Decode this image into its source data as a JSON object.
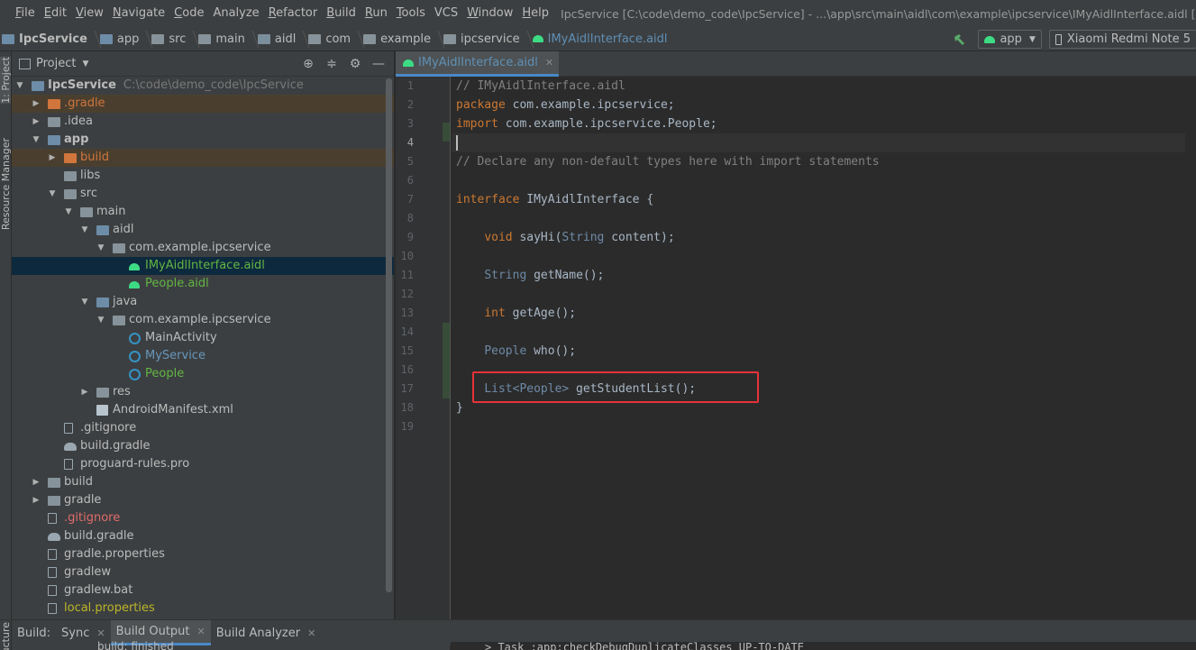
{
  "menubar": {
    "items": [
      {
        "label": "File",
        "u": "F",
        "rest": "ile"
      },
      {
        "label": "Edit",
        "u": "E",
        "rest": "dit"
      },
      {
        "label": "View",
        "u": "V",
        "rest": "iew"
      },
      {
        "label": "Navigate",
        "u": "N",
        "rest": "avigate"
      },
      {
        "label": "Code",
        "u": "C",
        "rest": "ode"
      },
      {
        "label": "Analyze",
        "u": "",
        "rest": "Analyze"
      },
      {
        "label": "Refactor",
        "u": "R",
        "rest": "efactor"
      },
      {
        "label": "Build",
        "u": "B",
        "rest": "uild"
      },
      {
        "label": "Run",
        "u": "R",
        "rest": "un"
      },
      {
        "label": "Tools",
        "u": "T",
        "rest": "ools"
      },
      {
        "label": "VCS",
        "u": "",
        "rest": "VCS"
      },
      {
        "label": "Window",
        "u": "W",
        "rest": "indow"
      },
      {
        "label": "Help",
        "u": "H",
        "rest": "elp"
      }
    ],
    "window_title": "IpcService [C:\\code\\demo_code\\IpcService] - ...\\app\\src\\main\\aidl\\com\\example\\ipcservice\\IMyAidlInterface.aidl [app] - Ar"
  },
  "breadcrumb": {
    "items": [
      "IpcService",
      "app",
      "src",
      "main",
      "aidl",
      "com",
      "example",
      "ipcservice",
      "IMyAidlInterface.aidl"
    ]
  },
  "run_tools": {
    "config": "app",
    "device": "Xiaomi Redmi Note 5"
  },
  "left_strip": {
    "project_tab": "1: Project",
    "resource_tab": "Resource Manager"
  },
  "project_panel": {
    "title": "Project",
    "root_name": "IpcService",
    "root_path": "C:\\code\\demo_code\\IpcService",
    "tree": [
      {
        "label": ".gradle",
        "depth": 1,
        "arrow": "right",
        "icon": "folder-orange",
        "style": "orange",
        "row": "excluded"
      },
      {
        "label": ".idea",
        "depth": 1,
        "arrow": "right",
        "icon": "folder",
        "style": "",
        "row": ""
      },
      {
        "label": "app",
        "depth": 1,
        "arrow": "down",
        "icon": "folder-blue",
        "style": "bold",
        "row": ""
      },
      {
        "label": "build",
        "depth": 2,
        "arrow": "right",
        "icon": "folder-orange",
        "style": "orange",
        "row": "excluded"
      },
      {
        "label": "libs",
        "depth": 2,
        "arrow": "",
        "icon": "folder",
        "style": "",
        "row": ""
      },
      {
        "label": "src",
        "depth": 2,
        "arrow": "down",
        "icon": "folder",
        "style": "",
        "row": ""
      },
      {
        "label": "main",
        "depth": 3,
        "arrow": "down",
        "icon": "folder",
        "style": "",
        "row": ""
      },
      {
        "label": "aidl",
        "depth": 4,
        "arrow": "down",
        "icon": "folder-blue",
        "style": "",
        "row": ""
      },
      {
        "label": "com.example.ipcservice",
        "depth": 5,
        "arrow": "down",
        "icon": "pkg",
        "style": "",
        "row": ""
      },
      {
        "label": "IMyAidlInterface.aidl",
        "depth": 6,
        "arrow": "",
        "icon": "android",
        "style": "green",
        "row": "selected"
      },
      {
        "label": "People.aidl",
        "depth": 6,
        "arrow": "",
        "icon": "android",
        "style": "green",
        "row": ""
      },
      {
        "label": "java",
        "depth": 4,
        "arrow": "down",
        "icon": "folder-blue",
        "style": "",
        "row": ""
      },
      {
        "label": "com.example.ipcservice",
        "depth": 5,
        "arrow": "down",
        "icon": "pkg",
        "style": "",
        "row": ""
      },
      {
        "label": "MainActivity",
        "depth": 6,
        "arrow": "",
        "icon": "class",
        "style": "",
        "row": ""
      },
      {
        "label": "MyService",
        "depth": 6,
        "arrow": "",
        "icon": "class",
        "style": "blue",
        "row": ""
      },
      {
        "label": "People",
        "depth": 6,
        "arrow": "",
        "icon": "class",
        "style": "green",
        "row": ""
      },
      {
        "label": "res",
        "depth": 4,
        "arrow": "right",
        "icon": "folder",
        "style": "",
        "row": ""
      },
      {
        "label": "AndroidManifest.xml",
        "depth": 4,
        "arrow": "",
        "icon": "manifest",
        "style": "",
        "row": ""
      },
      {
        "label": ".gitignore",
        "depth": 2,
        "arrow": "",
        "icon": "file",
        "style": "",
        "row": ""
      },
      {
        "label": "build.gradle",
        "depth": 2,
        "arrow": "",
        "icon": "gradle",
        "style": "",
        "row": ""
      },
      {
        "label": "proguard-rules.pro",
        "depth": 2,
        "arrow": "",
        "icon": "file",
        "style": "",
        "row": ""
      },
      {
        "label": "build",
        "depth": 1,
        "arrow": "right",
        "icon": "folder",
        "style": "",
        "row": ""
      },
      {
        "label": "gradle",
        "depth": 1,
        "arrow": "right",
        "icon": "folder",
        "style": "",
        "row": ""
      },
      {
        "label": ".gitignore",
        "depth": 1,
        "arrow": "",
        "icon": "file",
        "style": "red",
        "row": ""
      },
      {
        "label": "build.gradle",
        "depth": 1,
        "arrow": "",
        "icon": "gradle",
        "style": "",
        "row": ""
      },
      {
        "label": "gradle.properties",
        "depth": 1,
        "arrow": "",
        "icon": "file",
        "style": "",
        "row": ""
      },
      {
        "label": "gradlew",
        "depth": 1,
        "arrow": "",
        "icon": "file",
        "style": "",
        "row": ""
      },
      {
        "label": "gradlew.bat",
        "depth": 1,
        "arrow": "",
        "icon": "file",
        "style": "",
        "row": ""
      },
      {
        "label": "local.properties",
        "depth": 1,
        "arrow": "",
        "icon": "file",
        "style": "olive",
        "row": ""
      }
    ]
  },
  "editor": {
    "tab_label": "IMyAidlInterface.aidl",
    "current_line": 4,
    "lines": [
      [
        {
          "t": "// IMyAidlInterface.aidl",
          "c": "cm"
        }
      ],
      [
        {
          "t": "package",
          "c": "kw"
        },
        {
          "t": " com.example.ipcservice;",
          "c": ""
        }
      ],
      [
        {
          "t": "import",
          "c": "kw"
        },
        {
          "t": " com.example.ipcservice.People;",
          "c": ""
        }
      ],
      [],
      [
        {
          "t": "// Declare any non-default types here with import statements",
          "c": "cm"
        }
      ],
      [],
      [
        {
          "t": "interface",
          "c": "kw"
        },
        {
          "t": " IMyAidlInterface {",
          "c": ""
        }
      ],
      [],
      [
        {
          "t": "    ",
          "c": ""
        },
        {
          "t": "void",
          "c": "kw"
        },
        {
          "t": " sayHi(",
          "c": ""
        },
        {
          "t": "String",
          "c": "tcol"
        },
        {
          "t": " content);",
          "c": ""
        }
      ],
      [],
      [
        {
          "t": "    ",
          "c": ""
        },
        {
          "t": "String",
          "c": "tcol"
        },
        {
          "t": " getName();",
          "c": ""
        }
      ],
      [],
      [
        {
          "t": "    ",
          "c": ""
        },
        {
          "t": "int",
          "c": "kw"
        },
        {
          "t": " getAge();",
          "c": ""
        }
      ],
      [],
      [
        {
          "t": "    ",
          "c": ""
        },
        {
          "t": "People",
          "c": "tcol"
        },
        {
          "t": " who();",
          "c": ""
        }
      ],
      [],
      [
        {
          "t": "    ",
          "c": ""
        },
        {
          "t": "List<People>",
          "c": "tcol"
        },
        {
          "t": " getStudentList();",
          "c": ""
        }
      ],
      [
        {
          "t": "}",
          "c": ""
        }
      ],
      []
    ]
  },
  "bottom": {
    "lead": "Build:",
    "tabs": [
      {
        "label": "Sync",
        "active": false
      },
      {
        "label": "Build Output",
        "active": true
      },
      {
        "label": "Build Analyzer",
        "active": false
      }
    ],
    "side_tab": "Structure",
    "console_peek": "> Task :app:checkDebugDuplicateClasses UP-TO-DATE",
    "tree_peek": "build: finished"
  }
}
